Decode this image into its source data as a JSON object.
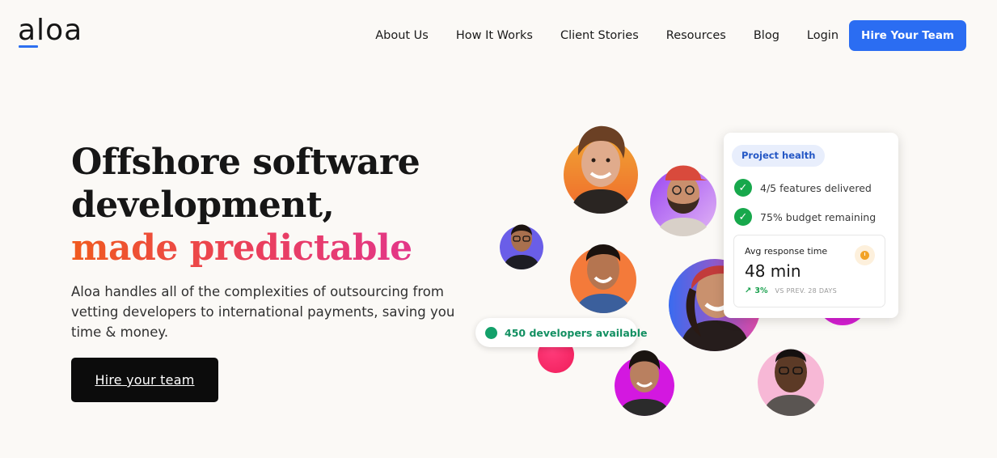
{
  "header": {
    "logo_text": "aloa",
    "nav": [
      {
        "label": "About Us"
      },
      {
        "label": "How It Works"
      },
      {
        "label": "Client Stories"
      },
      {
        "label": "Resources"
      },
      {
        "label": "Blog"
      },
      {
        "label": "Login"
      }
    ],
    "cta_label": "Hire Your Team"
  },
  "hero": {
    "headline_line1": "Offshore software",
    "headline_line2": "development,",
    "headline_highlight": "made predictable",
    "subcopy": "Aloa handles all of the complexities of outsourcing from vetting developers to international payments, saving you time & money.",
    "cta_label": "Hire your team"
  },
  "developers_pill": {
    "label": "450 developers available"
  },
  "project_health": {
    "tag": "Project health",
    "checks": [
      "4/5 features delivered",
      "75% budget remaining"
    ],
    "response": {
      "label": "Avg response time",
      "value": "48 min",
      "trend": "3%",
      "trend_note": "VS PREV. 28 DAYS"
    }
  },
  "colors": {
    "accent_blue": "#2b6df2",
    "headline_gradient_start": "#f05a1e",
    "headline_gradient_end": "#e0339a",
    "success_green": "#17a84c"
  }
}
